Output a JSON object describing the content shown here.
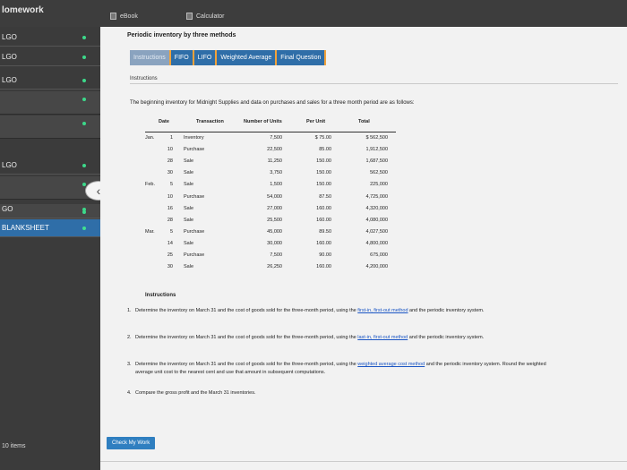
{
  "app": {
    "title": "lomework",
    "items_count": "10 items"
  },
  "top_tabs": [
    {
      "label": "eBook",
      "icon": "book-icon"
    },
    {
      "label": "Calculator",
      "icon": "calculator-icon"
    }
  ],
  "sidebar": {
    "items": [
      {
        "label": "LGO"
      },
      {
        "label": "LGO"
      },
      {
        "label": "LGO"
      },
      {
        "label": ""
      },
      {
        "label": ""
      },
      {
        "label": "LGO"
      },
      {
        "label": ""
      },
      {
        "label": ""
      },
      {
        "label": "GO"
      },
      {
        "label": "BLANKSHEET"
      }
    ]
  },
  "main": {
    "title": "Periodic inventory by three methods",
    "tabs": [
      {
        "label": "Instructions"
      },
      {
        "label": "FIFO"
      },
      {
        "label": "LIFO"
      },
      {
        "label": "Weighted Average"
      },
      {
        "label": "Final Question"
      }
    ],
    "section_label": "Instructions",
    "intro": "The beginning inventory for Midnight Supplies and data on purchases and sales for a three month period are as follows:",
    "check_button": "Check My Work"
  },
  "table": {
    "headers": [
      "Date",
      "Transaction",
      "Number of Units",
      "Per Unit",
      "Total"
    ],
    "rows": [
      {
        "month": "Jan.",
        "day": "1",
        "txn": "Inventory",
        "units": "7,500",
        "per": "$ 75.00",
        "total": "$ 562,500"
      },
      {
        "month": "",
        "day": "10",
        "txn": "Purchase",
        "units": "22,500",
        "per": "85.00",
        "total": "1,912,500"
      },
      {
        "month": "",
        "day": "28",
        "txn": "Sale",
        "units": "11,250",
        "per": "150.00",
        "total": "1,687,500"
      },
      {
        "month": "",
        "day": "30",
        "txn": "Sale",
        "units": "3,750",
        "per": "150.00",
        "total": "562,500"
      },
      {
        "month": "Feb.",
        "day": "5",
        "txn": "Sale",
        "units": "1,500",
        "per": "150.00",
        "total": "225,000"
      },
      {
        "month": "",
        "day": "10",
        "txn": "Purchase",
        "units": "54,000",
        "per": "87.50",
        "total": "4,725,000"
      },
      {
        "month": "",
        "day": "16",
        "txn": "Sale",
        "units": "27,000",
        "per": "160.00",
        "total": "4,320,000"
      },
      {
        "month": "",
        "day": "28",
        "txn": "Sale",
        "units": "25,500",
        "per": "160.00",
        "total": "4,080,000"
      },
      {
        "month": "Mar.",
        "day": "5",
        "txn": "Purchase",
        "units": "45,000",
        "per": "89.50",
        "total": "4,027,500"
      },
      {
        "month": "",
        "day": "14",
        "txn": "Sale",
        "units": "30,000",
        "per": "160.00",
        "total": "4,800,000"
      },
      {
        "month": "",
        "day": "25",
        "txn": "Purchase",
        "units": "7,500",
        "per": "90.00",
        "total": "675,000"
      },
      {
        "month": "",
        "day": "30",
        "txn": "Sale",
        "units": "26,250",
        "per": "160.00",
        "total": "4,200,000"
      }
    ]
  },
  "instructions": {
    "title": "Instructions",
    "items": [
      {
        "num": "1.",
        "pre": "Determine the inventory on March 31 and the cost of goods sold for the three-month period, using the ",
        "link": "first-in, first-out method",
        "post": " and the periodic inventory system."
      },
      {
        "num": "2.",
        "pre": "Determine the inventory on March 31 and the cost of goods sold for the three-month period, using the ",
        "link": "last-in, first-out method",
        "post": " and the periodic inventory system."
      },
      {
        "num": "3.",
        "pre": "Determine the inventory on March 31 and the cost of goods sold for the three-month period, using the ",
        "link": "weighted average cost method",
        "post": " and the periodic inventory system. Round the weighted average unit cost to the nearest cent and use that amount in subsequent computations."
      },
      {
        "num": "4.",
        "pre": "Compare the gross profit and the March 31 inventories.",
        "link": "",
        "post": ""
      }
    ]
  },
  "colors": {
    "accent": "#2f6ea8",
    "tab_divider": "#f2a23a",
    "status_dot": "#3cd98a",
    "sidebar": "#3b3b3b"
  }
}
